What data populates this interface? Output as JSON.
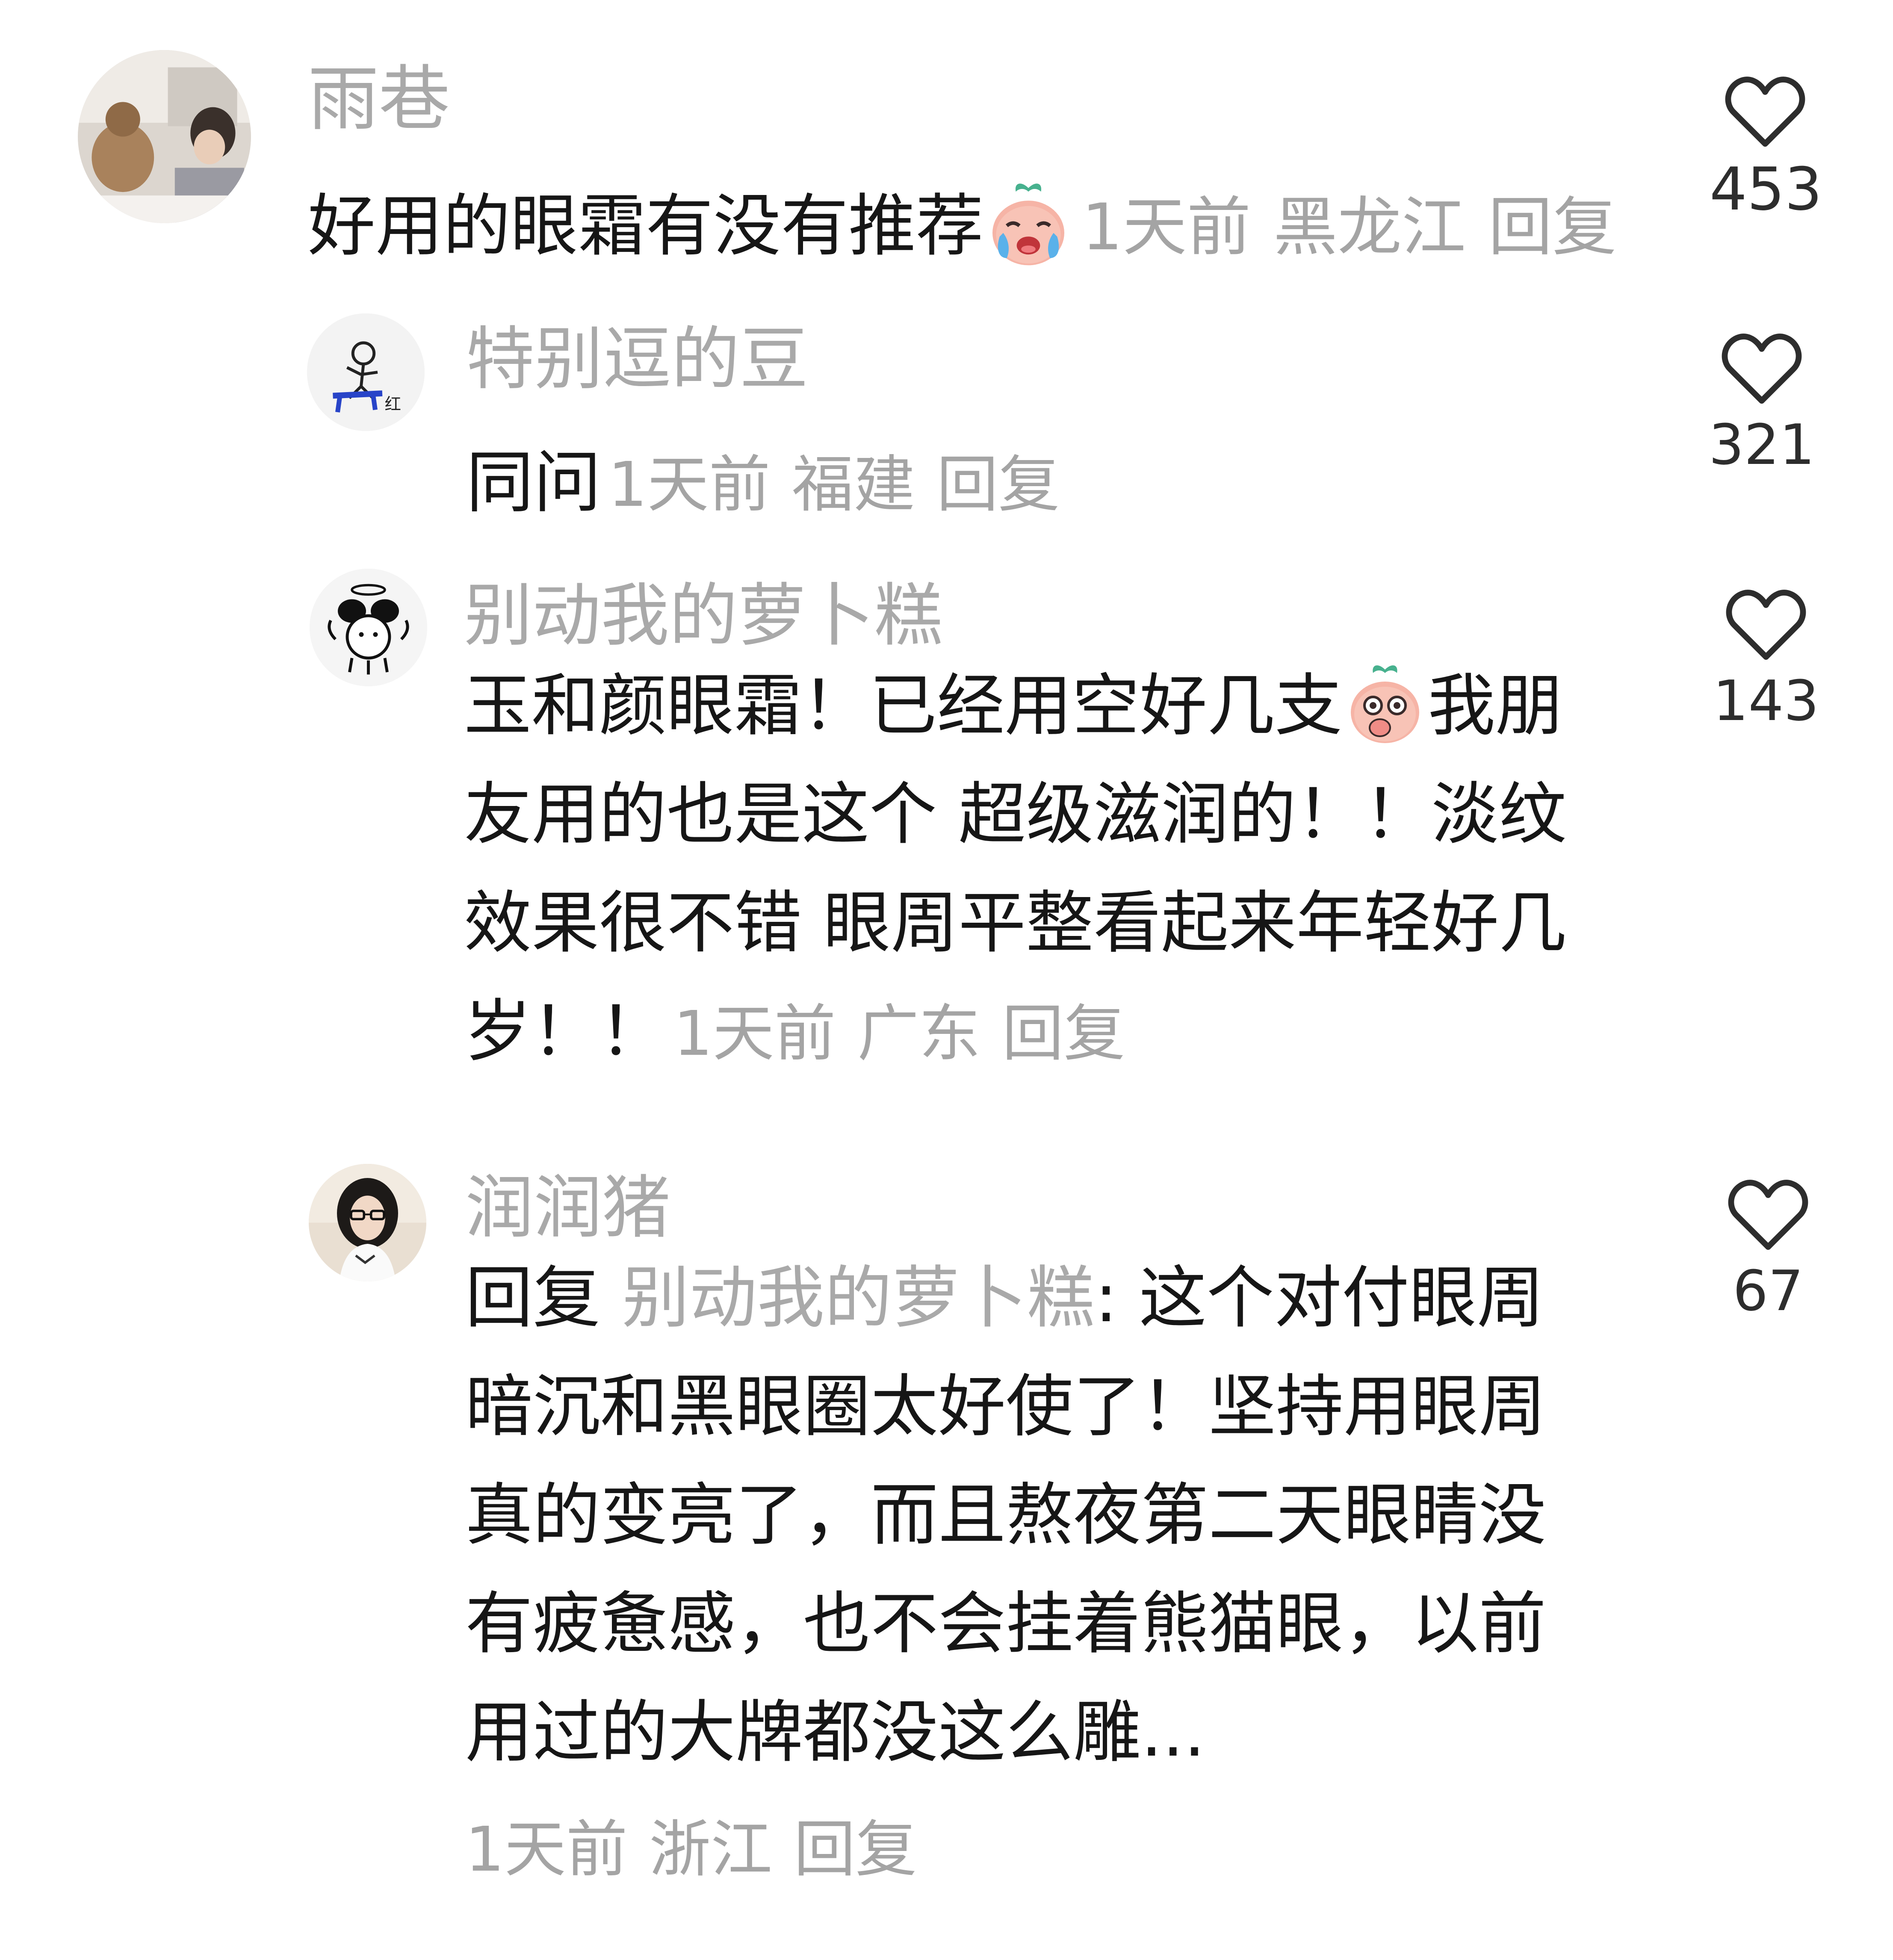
{
  "colors": {
    "username": "#a9a9a9",
    "text": "#161616",
    "meta": "#a4a4a4",
    "like_count": "#2d2d2d",
    "background": "#ffffff"
  },
  "comments": [
    {
      "username": "雨巷",
      "text": "好用的眼霜有没有推荐",
      "emoji": "crying-peach-emoji",
      "time": "1天前",
      "location": "黑龙江",
      "reply_label": "回复",
      "likes": "453",
      "like_icon": "heart-outline-icon",
      "avatar": "photo-avatar-with-cat"
    },
    {
      "username": "特别逗的豆",
      "text": "同问",
      "time": "1天前",
      "location": "福建",
      "reply_label": "回复",
      "likes": "321",
      "like_icon": "heart-outline-icon",
      "avatar": "sketch-doodle-avatar"
    },
    {
      "username": "别动我的萝卜糕",
      "text_before_emoji": "玉和颜眼霜！已经用空好几支",
      "emoji": "shocked-peach-emoji",
      "text_after_emoji": "我朋友用的也是这个 超级滋润的！！淡纹效果很不错 眼周平整看起来年轻好几岁！！",
      "time": "1天前",
      "location": "广东",
      "reply_label": "回复",
      "likes": "143",
      "like_icon": "heart-outline-icon",
      "avatar": "cartoon-angel-avatar"
    },
    {
      "username": "润润猪",
      "reply_prefix": "回复",
      "mention": "别动我的萝卜糕",
      "text": ": 这个对付眼周暗沉和黑眼圈太好使了！坚持用眼周真的变亮了，而且熬夜第二天眼睛没有疲惫感，也不会挂着熊猫眼，以前用过的大牌都没这么雕...",
      "time": "1天前",
      "location": "浙江",
      "reply_label": "回复",
      "likes": "67",
      "like_icon": "heart-outline-icon",
      "avatar": "photo-avatar-girl-glasses"
    }
  ]
}
